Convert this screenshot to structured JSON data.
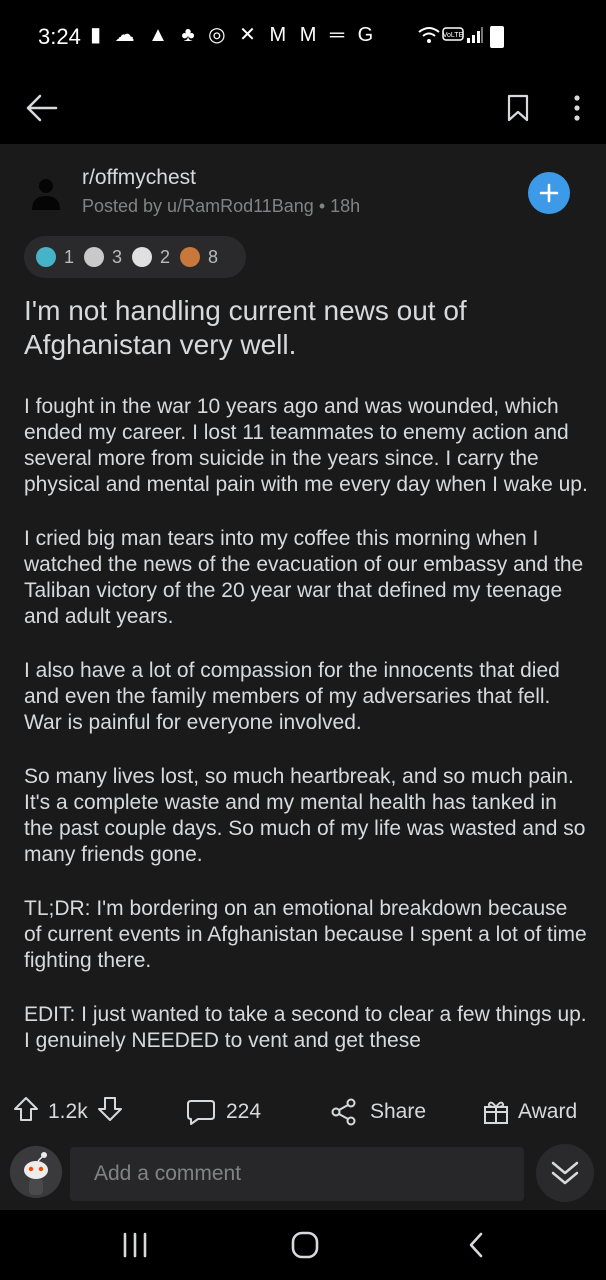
{
  "status_bar": {
    "time": "3:24",
    "notification_icons": "▮ ☁ ▲ ♣ ◎ ✕ M M ═ G",
    "system_icons": "wifi volte signal"
  },
  "post": {
    "subreddit": "r/offmychest",
    "posted_by": "Posted by u/RamRod11Bang • 18h",
    "awards": [
      {
        "icon": "helpful-award-icon",
        "count": "1",
        "color": "#46b3c7"
      },
      {
        "icon": "wholesome-award-icon",
        "count": "3",
        "color": "#c9c9c9"
      },
      {
        "icon": "silver-award-icon",
        "count": "2",
        "color": "#e0e0e0"
      },
      {
        "icon": "hug-award-icon",
        "count": "8",
        "color": "#c8783a"
      }
    ],
    "title": "I'm not handling current news out of Afghanistan very well.",
    "paragraphs": [
      "I fought in the war 10 years ago and was wounded, which ended my career. I lost 11 teammates to enemy action and several more from suicide in the years since. I carry the physical and mental pain with me every day when I wake up.",
      "I cried big man tears into my coffee this morning when I watched the news of the evacuation of our embassy and the Taliban victory of the 20 year war that defined my teenage and adult years.",
      "I also have a lot of compassion for the innocents that died and even the family members of my adversaries that fell. War is painful for everyone involved.",
      "So many lives lost, so much heartbreak, and so much pain. It's a complete waste and my mental health has tanked in the past couple days. So much of my life was wasted and so many friends gone.",
      "TL;DR: I'm bordering on an emotional breakdown because of current events in Afghanistan because I spent a lot of time fighting there.",
      "EDIT: I just wanted to take a second to clear a few things up. I genuinely NEEDED to vent and get these"
    ]
  },
  "actions": {
    "vote_count": "1.2k",
    "comment_count": "224",
    "share_label": "Share",
    "award_label": "Award"
  },
  "comment_box": {
    "placeholder": "Add a comment"
  },
  "colors": {
    "accent": "#3c9ae8",
    "surface": "#1a1a1b",
    "text": "#d7dadc",
    "muted": "#818384"
  }
}
